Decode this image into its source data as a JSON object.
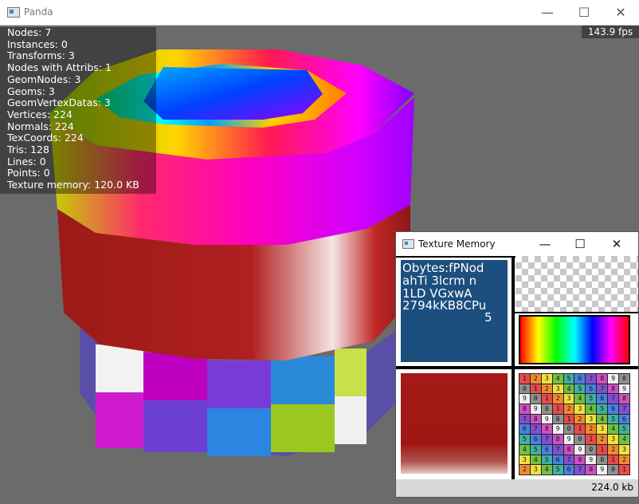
{
  "window": {
    "title": "Panda",
    "min_label": "—",
    "max_label": "☐",
    "close_label": "✕"
  },
  "stats": {
    "lines": [
      "Nodes: 7",
      "Instances: 0",
      "Transforms: 3",
      "Nodes with Attribs: 1",
      "GeomNodes: 3",
      "Geoms: 3",
      "GeomVertexDatas: 3",
      "Vertices: 224",
      "Normals: 224",
      "TexCoords: 224",
      "Tris: 128",
      "Lines: 0",
      "Points: 0",
      "Texture memory: 120.0 KB"
    ]
  },
  "fps": "143.9 fps",
  "texture_memory_window": {
    "title": "Texture Memory",
    "min_label": "—",
    "max_label": "☐",
    "close_label": "✕",
    "status": "224.0 kb",
    "label_texture_text": [
      "Obytes:fPNod",
      "ahTi 3lcrm n",
      "1LD VGxwA",
      "2794kKB8CPu",
      "5"
    ]
  },
  "number_grid": [
    "1234567890",
    "0123456789",
    "9012345678",
    "8901234567",
    "7890123456",
    "6789012345",
    "5678901234",
    "4567890123",
    "3456789012",
    "2345678901"
  ],
  "colors": {
    "background": "#6b6b6b",
    "label_tex": "#1c4e7e",
    "red_tex": "#a51a17"
  }
}
